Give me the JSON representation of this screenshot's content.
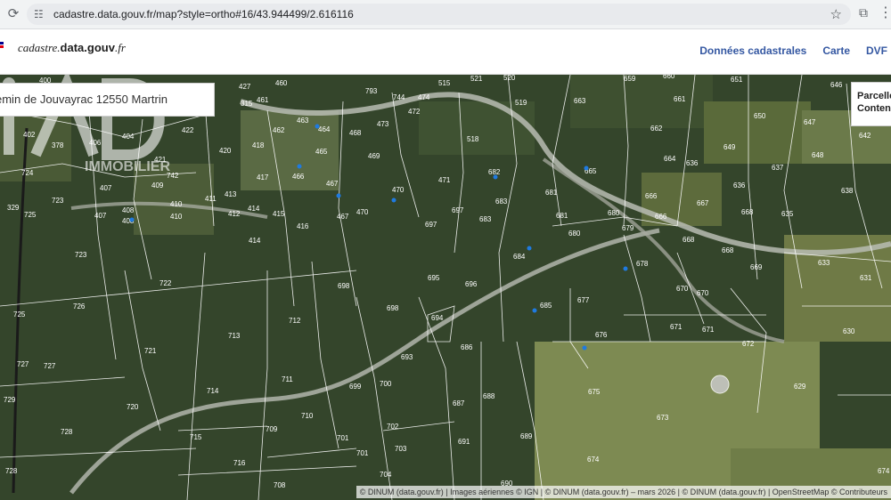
{
  "browser": {
    "url": "cadastre.data.gouv.fr/map?style=ortho#16/43.944499/2.616116"
  },
  "site": {
    "logo_main": "cadastre.",
    "logo_bold": "data.gouv",
    "logo_tail": ".fr",
    "nav": [
      {
        "label": "Données cadastrales"
      },
      {
        "label": "Carte"
      },
      {
        "label": "DVF"
      }
    ]
  },
  "map": {
    "search_value": "emin de Jouvayrac 12550 Martrin",
    "info_panel": {
      "line1": "Parcelle",
      "line2": "Contena"
    },
    "attribution": "© DINUM (data.gouv.fr) | Images aériennes © IGN | © DINUM (data.gouv.fr) – mars 2026 | © DINUM (data.gouv.fr) | OpenStreetMap © Contributeurs",
    "watermark": "iAD IMMOBILIER",
    "parcels": [
      {
        "n": "400"
      },
      {
        "n": "427"
      },
      {
        "n": "460"
      },
      {
        "n": "793"
      },
      {
        "n": "744"
      },
      {
        "n": "474"
      },
      {
        "n": "515"
      },
      {
        "n": "521"
      },
      {
        "n": "520"
      },
      {
        "n": "659"
      },
      {
        "n": "660"
      },
      {
        "n": "651"
      },
      {
        "n": "646"
      },
      {
        "n": "315"
      },
      {
        "n": "461"
      },
      {
        "n": "472"
      },
      {
        "n": "519"
      },
      {
        "n": "663"
      },
      {
        "n": "661"
      },
      {
        "n": "650"
      },
      {
        "n": "647"
      },
      {
        "n": "402"
      },
      {
        "n": "378"
      },
      {
        "n": "406"
      },
      {
        "n": "404"
      },
      {
        "n": "422"
      },
      {
        "n": "463"
      },
      {
        "n": "462"
      },
      {
        "n": "464"
      },
      {
        "n": "468"
      },
      {
        "n": "473"
      },
      {
        "n": "518"
      },
      {
        "n": "662"
      },
      {
        "n": "649"
      },
      {
        "n": "642"
      },
      {
        "n": "418"
      },
      {
        "n": "420"
      },
      {
        "n": "421"
      },
      {
        "n": "465"
      },
      {
        "n": "469"
      },
      {
        "n": "664"
      },
      {
        "n": "636"
      },
      {
        "n": "637"
      },
      {
        "n": "648"
      },
      {
        "n": "724"
      },
      {
        "n": "742"
      },
      {
        "n": "417"
      },
      {
        "n": "466"
      },
      {
        "n": "682"
      },
      {
        "n": "665"
      },
      {
        "n": "471"
      },
      {
        "n": "407"
      },
      {
        "n": "409"
      },
      {
        "n": "467"
      },
      {
        "n": "470"
      },
      {
        "n": "683"
      },
      {
        "n": "681"
      },
      {
        "n": "666"
      },
      {
        "n": "638"
      },
      {
        "n": "723"
      },
      {
        "n": "411"
      },
      {
        "n": "413"
      },
      {
        "n": "410"
      },
      {
        "n": "636"
      },
      {
        "n": "667"
      },
      {
        "n": "668"
      },
      {
        "n": "635"
      },
      {
        "n": "329"
      },
      {
        "n": "725"
      },
      {
        "n": "407"
      },
      {
        "n": "408"
      },
      {
        "n": "412"
      },
      {
        "n": "414"
      },
      {
        "n": "415"
      },
      {
        "n": "697"
      },
      {
        "n": "683"
      },
      {
        "n": "681"
      },
      {
        "n": "680"
      },
      {
        "n": "666"
      },
      {
        "n": "408"
      },
      {
        "n": "410"
      },
      {
        "n": "416"
      },
      {
        "n": "467"
      },
      {
        "n": "470"
      },
      {
        "n": "697"
      },
      {
        "n": "679"
      },
      {
        "n": "414"
      },
      {
        "n": "680"
      },
      {
        "n": "668"
      },
      {
        "n": "723"
      },
      {
        "n": "684"
      },
      {
        "n": "678"
      },
      {
        "n": "668"
      },
      {
        "n": "669"
      },
      {
        "n": "633"
      },
      {
        "n": "631"
      },
      {
        "n": "722"
      },
      {
        "n": "698"
      },
      {
        "n": "695"
      },
      {
        "n": "696"
      },
      {
        "n": "670"
      },
      {
        "n": "670"
      },
      {
        "n": "726"
      },
      {
        "n": "685"
      },
      {
        "n": "677"
      },
      {
        "n": "725"
      },
      {
        "n": "698"
      },
      {
        "n": "712"
      },
      {
        "n": "694"
      },
      {
        "n": "671"
      },
      {
        "n": "671"
      },
      {
        "n": "630"
      },
      {
        "n": "713"
      },
      {
        "n": "676"
      },
      {
        "n": "721"
      },
      {
        "n": "686"
      },
      {
        "n": "672"
      },
      {
        "n": "693"
      },
      {
        "n": "727"
      },
      {
        "n": "727"
      },
      {
        "n": "711"
      },
      {
        "n": "700"
      },
      {
        "n": "699"
      },
      {
        "n": "714"
      },
      {
        "n": "675"
      },
      {
        "n": "629"
      },
      {
        "n": "729"
      },
      {
        "n": "688"
      },
      {
        "n": "687"
      },
      {
        "n": "720"
      },
      {
        "n": "710"
      },
      {
        "n": "673"
      },
      {
        "n": "728"
      },
      {
        "n": "709"
      },
      {
        "n": "702"
      },
      {
        "n": "715"
      },
      {
        "n": "701"
      },
      {
        "n": "691"
      },
      {
        "n": "689"
      },
      {
        "n": "703"
      },
      {
        "n": "701"
      },
      {
        "n": "674"
      },
      {
        "n": "716"
      },
      {
        "n": "728"
      },
      {
        "n": "704"
      },
      {
        "n": "708"
      },
      {
        "n": "690"
      },
      {
        "n": "674"
      }
    ]
  },
  "colors": {
    "nav_link": "#3558a2",
    "marianne_blue": "#000091",
    "marianne_red": "#e1000f"
  }
}
